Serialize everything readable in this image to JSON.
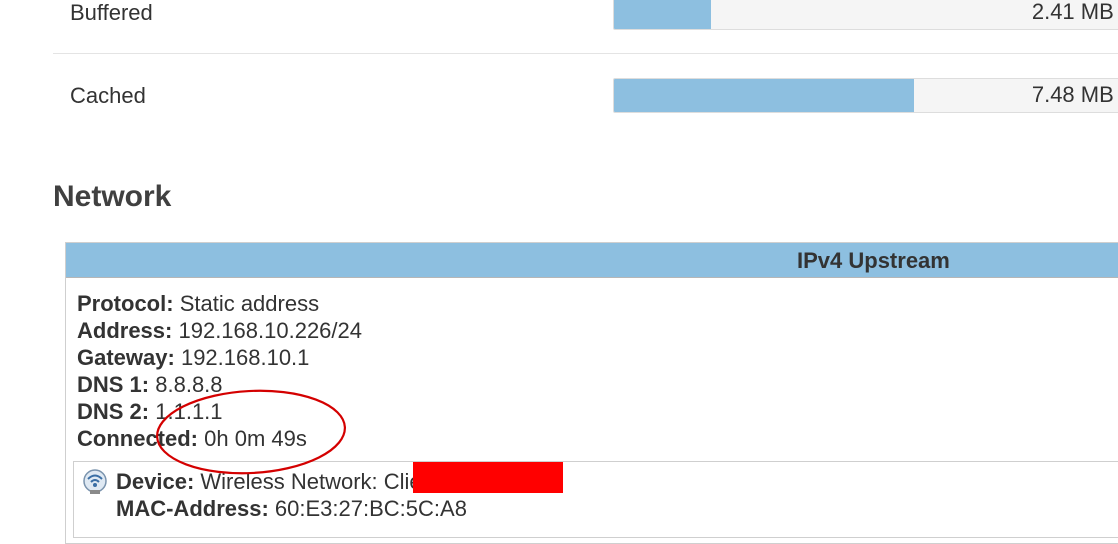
{
  "memory": {
    "buffered": {
      "label": "Buffered",
      "value_text": "2.41 MB /",
      "fill_fraction": 0.186
    },
    "cached": {
      "label": "Cached",
      "value_text": "7.48 MB /",
      "fill_fraction": 0.576
    }
  },
  "network": {
    "section_title": "Network",
    "panel_header": "IPv4 Upstream",
    "protocol": {
      "label": "Protocol:",
      "value": "Static address"
    },
    "address": {
      "label": "Address:",
      "value": "192.168.10.226/24"
    },
    "gateway": {
      "label": "Gateway:",
      "value": "192.168.10.1"
    },
    "dns1": {
      "label": "DNS 1:",
      "value": "8.8.8.8"
    },
    "dns2": {
      "label": "DNS 2:",
      "value": "1.1.1.1"
    },
    "connected": {
      "label": "Connected:",
      "value": "0h 0m 49s"
    },
    "device": {
      "label": "Device:",
      "value": "Wireless Network: Client \"d",
      "value_suffix": "\"",
      "icon": "wireless-network-icon"
    },
    "mac": {
      "label": "MAC-Address:",
      "value": "60:E3:27:BC:5C:A8"
    }
  },
  "colors": {
    "bar_fill": "#8dbfe0",
    "header_bg": "#8dbfe0",
    "annotation": "#d40000",
    "redaction": "#ff0000"
  }
}
